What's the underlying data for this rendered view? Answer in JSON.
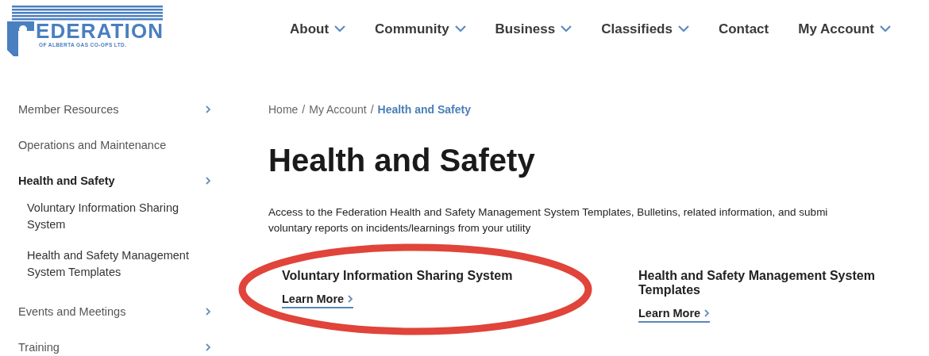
{
  "logo": {
    "name": "EDERATION",
    "subtitle": "OF ALBERTA GAS CO-OPS LTD."
  },
  "nav": [
    {
      "label": "About",
      "dropdown": true
    },
    {
      "label": "Community",
      "dropdown": true
    },
    {
      "label": "Business",
      "dropdown": true
    },
    {
      "label": "Classifieds",
      "dropdown": true
    },
    {
      "label": "Contact",
      "dropdown": false
    },
    {
      "label": "My Account",
      "dropdown": true
    }
  ],
  "sidebar": {
    "items": [
      {
        "label": "Member Resources",
        "selected": false,
        "has_children": true
      },
      {
        "label": "Operations and Maintenance",
        "selected": false,
        "has_children": false
      },
      {
        "label": "Health and Safety",
        "selected": true,
        "has_children": true,
        "children": [
          {
            "label": "Voluntary Information Sharing System"
          },
          {
            "label": "Health and Safety Management System Templates"
          }
        ]
      },
      {
        "label": "Events and Meetings",
        "selected": false,
        "has_children": true
      },
      {
        "label": "Training",
        "selected": false,
        "has_children": true
      }
    ]
  },
  "breadcrumb": [
    {
      "label": "Home",
      "current": false,
      "separator": "/"
    },
    {
      "label": "My Account",
      "current": false,
      "separator": "/"
    },
    {
      "label": "Health and Safety",
      "current": true
    }
  ],
  "title": "Health and Safety",
  "description_lines": [
    "Access to the Federation Health and Safety Management System Templates, Bulletins, related information, and submi",
    "voluntary reports on incidents/learnings from your utility"
  ],
  "cards": [
    {
      "title": "Voluntary Information Sharing System",
      "link": "Learn More",
      "circled": true
    },
    {
      "title": "Health and Safety Management System Templates",
      "link": "Learn More",
      "circled": false
    }
  ]
}
